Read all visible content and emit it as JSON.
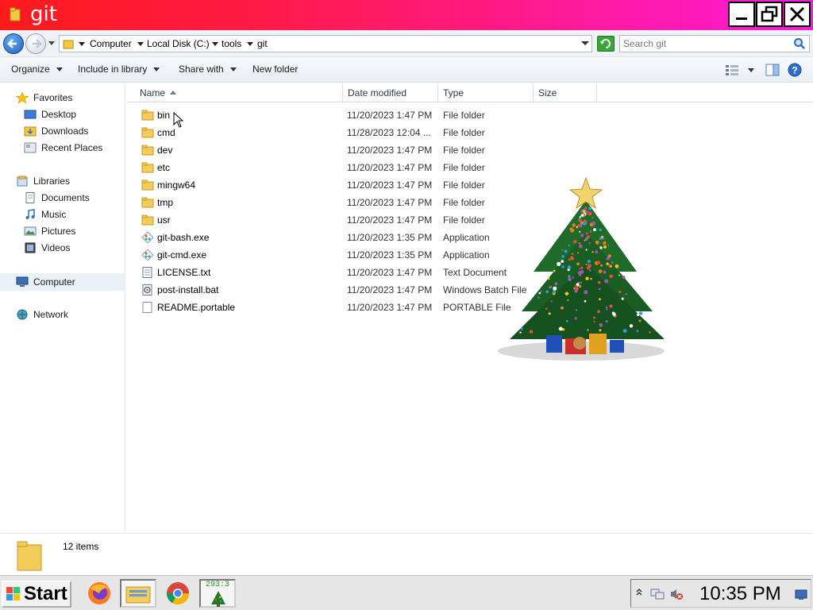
{
  "window": {
    "title": "git",
    "icons": {
      "folder": "folder-icon",
      "minimize": "minimize-icon",
      "maximize": "restore-icon",
      "close": "close-icon"
    }
  },
  "address": {
    "crumbs": [
      "Computer",
      "Local Disk (C:)",
      "tools",
      "git"
    ],
    "search_placeholder": "Search git"
  },
  "toolbar": {
    "organize": "Organize",
    "include_in_library": "Include in library",
    "share_with": "Share with",
    "new_folder": "New folder"
  },
  "sidebar": {
    "favorites": {
      "label": "Favorites",
      "items": [
        "Desktop",
        "Downloads",
        "Recent Places"
      ]
    },
    "libraries": {
      "label": "Libraries",
      "items": [
        "Documents",
        "Music",
        "Pictures",
        "Videos"
      ]
    },
    "computer": "Computer",
    "network": "Network"
  },
  "columns": [
    "Name",
    "Date modified",
    "Type",
    "Size"
  ],
  "files": [
    {
      "name": "bin",
      "date": "11/20/2023 1:47 PM",
      "type": "File folder",
      "icon": "folder-icon"
    },
    {
      "name": "cmd",
      "date": "11/28/2023 12:04 ...",
      "type": "File folder",
      "icon": "folder-icon"
    },
    {
      "name": "dev",
      "date": "11/20/2023 1:47 PM",
      "type": "File folder",
      "icon": "folder-icon"
    },
    {
      "name": "etc",
      "date": "11/20/2023 1:47 PM",
      "type": "File folder",
      "icon": "folder-icon"
    },
    {
      "name": "mingw64",
      "date": "11/20/2023 1:47 PM",
      "type": "File folder",
      "icon": "folder-icon"
    },
    {
      "name": "tmp",
      "date": "11/20/2023 1:47 PM",
      "type": "File folder",
      "icon": "folder-icon"
    },
    {
      "name": "usr",
      "date": "11/20/2023 1:47 PM",
      "type": "File folder",
      "icon": "folder-icon"
    },
    {
      "name": "git-bash.exe",
      "date": "11/20/2023 1:35 PM",
      "type": "Application",
      "icon": "git-icon"
    },
    {
      "name": "git-cmd.exe",
      "date": "11/20/2023 1:35 PM",
      "type": "Application",
      "icon": "git-icon"
    },
    {
      "name": "LICENSE.txt",
      "date": "11/20/2023 1:47 PM",
      "type": "Text Document",
      "icon": "text-file-icon"
    },
    {
      "name": "post-install.bat",
      "date": "11/20/2023 1:47 PM",
      "type": "Windows Batch File",
      "icon": "batch-file-icon"
    },
    {
      "name": "README.portable",
      "date": "11/20/2023 1:47 PM",
      "type": "PORTABLE File",
      "icon": "generic-file-icon"
    }
  ],
  "status": {
    "count": "12 items"
  },
  "taskbar": {
    "start": "Start",
    "tree_counter": "293:3",
    "clock": "10:35 PM"
  },
  "colors": {
    "title_gradient_start": "#ff1a1a",
    "title_gradient_end": "#ff1add",
    "accent": "#1f5fb8"
  }
}
